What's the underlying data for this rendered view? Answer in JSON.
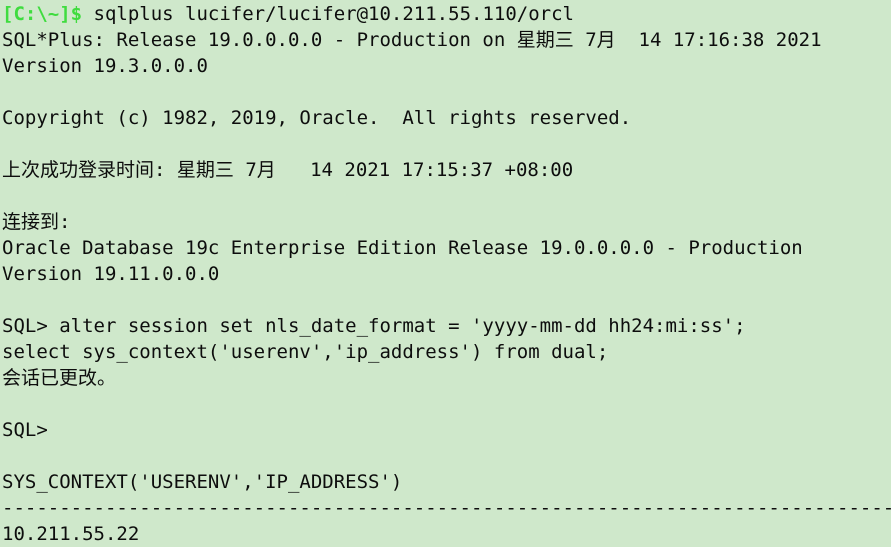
{
  "terminal": {
    "background_color": "#cfe8cb",
    "foreground_color": "#0d0d0d",
    "prompt_color": "#3fdc3f",
    "lines": [
      {
        "id": "line-shell-prompt",
        "prompt": "[C:\\~]$",
        "command": " sqlplus lucifer/lucifer@10.211.55.110/orcl"
      },
      {
        "id": "line-sqlplus-release",
        "text": "SQL*Plus: Release 19.0.0.0.0 - Production on 星期三 7月  14 17:16:38 2021"
      },
      {
        "id": "line-sqlplus-version",
        "text": "Version 19.3.0.0.0"
      },
      {
        "id": "line-blank-1",
        "text": ""
      },
      {
        "id": "line-copyright",
        "text": "Copyright (c) 1982, 2019, Oracle.  All rights reserved."
      },
      {
        "id": "line-blank-2",
        "text": ""
      },
      {
        "id": "line-last-login",
        "text": "上次成功登录时间: 星期三 7月   14 2021 17:15:37 +08:00"
      },
      {
        "id": "line-blank-3",
        "text": ""
      },
      {
        "id": "line-connected-to",
        "text": "连接到:"
      },
      {
        "id": "line-db-edition",
        "text": "Oracle Database 19c Enterprise Edition Release 19.0.0.0.0 - Production"
      },
      {
        "id": "line-db-version",
        "text": "Version 19.11.0.0.0"
      },
      {
        "id": "line-blank-4",
        "text": ""
      },
      {
        "id": "line-alter-session",
        "text": "SQL> alter session set nls_date_format = 'yyyy-mm-dd hh24:mi:ss';"
      },
      {
        "id": "line-select-sys-context",
        "text": "select sys_context('userenv','ip_address') from dual;"
      },
      {
        "id": "line-session-altered",
        "text": "会话已更改。"
      },
      {
        "id": "line-blank-5",
        "text": ""
      },
      {
        "id": "line-sql-prompt-2",
        "text": "SQL>"
      },
      {
        "id": "line-blank-6",
        "text": ""
      },
      {
        "id": "line-column-header",
        "text": "SYS_CONTEXT('USERENV','IP_ADDRESS')"
      },
      {
        "id": "line-separator",
        "text": "--------------------------------------------------------------------------------"
      },
      {
        "id": "line-result-value",
        "text": "10.211.55.22"
      }
    ]
  }
}
